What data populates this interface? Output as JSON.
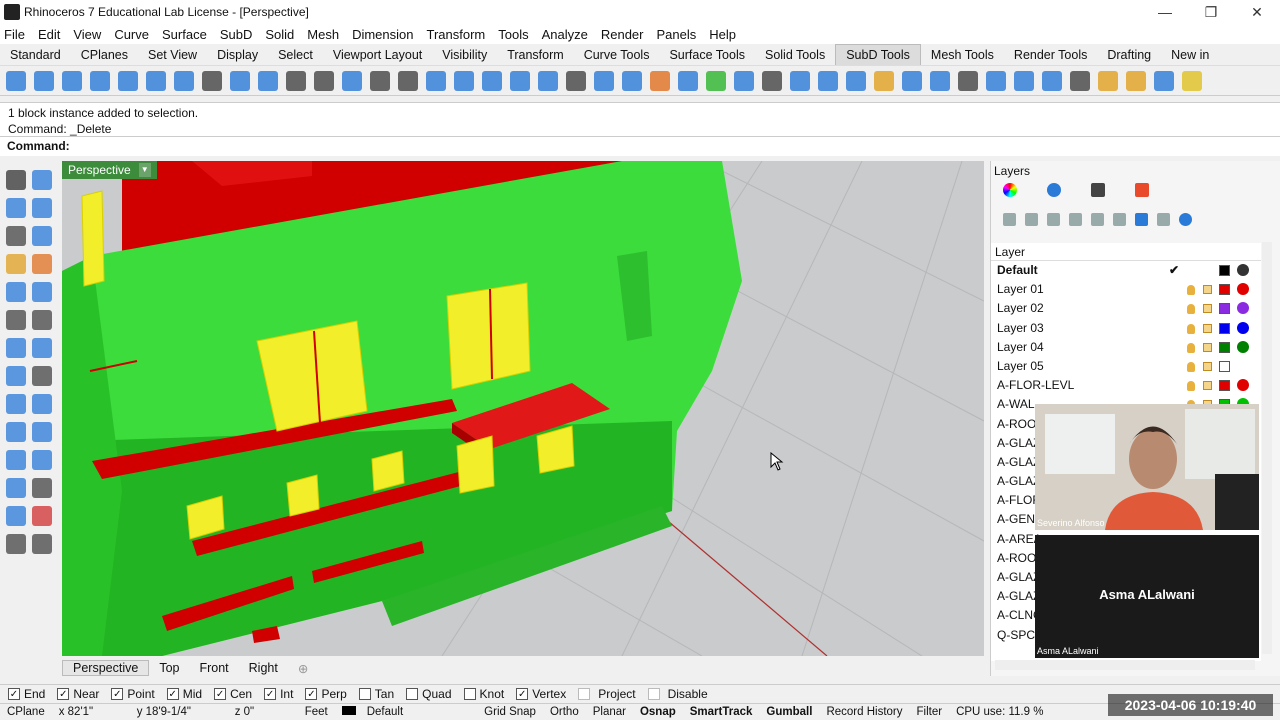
{
  "window": {
    "title": "Rhinoceros 7 Educational Lab License - [Perspective]"
  },
  "menu": [
    "File",
    "Edit",
    "View",
    "Curve",
    "Surface",
    "SubD",
    "Solid",
    "Mesh",
    "Dimension",
    "Transform",
    "Tools",
    "Analyze",
    "Render",
    "Panels",
    "Help"
  ],
  "tabs": [
    "Standard",
    "CPlanes",
    "Set View",
    "Display",
    "Select",
    "Viewport Layout",
    "Visibility",
    "Transform",
    "Curve Tools",
    "Surface Tools",
    "Solid Tools",
    "SubD Tools",
    "Mesh Tools",
    "Render Tools",
    "Drafting",
    "New in"
  ],
  "active_tab": "SubD Tools",
  "command": {
    "history": [
      "1 block instance added to selection.",
      "Command: _Delete"
    ],
    "prompt": "Command:"
  },
  "viewport": {
    "name": "Perspective"
  },
  "view_tabs": [
    "Perspective",
    "Top",
    "Front",
    "Right"
  ],
  "layers_panel": {
    "title": "Layers",
    "column_header": "Layer",
    "layers": [
      {
        "name": "Default",
        "current": true,
        "color": "#000000",
        "material": "#333333"
      },
      {
        "name": "Layer 01",
        "color": "#e00000",
        "material": "#e00000"
      },
      {
        "name": "Layer 02",
        "color": "#8a2be2",
        "material": "#8a2be2"
      },
      {
        "name": "Layer 03",
        "color": "#0000ee",
        "material": "#0000ee"
      },
      {
        "name": "Layer 04",
        "color": "#008000",
        "material": "#008000"
      },
      {
        "name": "Layer 05",
        "color": "#ffffff",
        "material": "#ffffff"
      },
      {
        "name": "A-FLOR-LEVL",
        "color": "#e00000",
        "material": "#e00000"
      },
      {
        "name": "A-WAL",
        "color": "#00c000",
        "material": "#00c000"
      },
      {
        "name": "A-ROO",
        "color": "",
        "material": ""
      },
      {
        "name": "A-GLAZ",
        "color": "",
        "material": ""
      },
      {
        "name": "A-GLAZ",
        "color": "",
        "material": ""
      },
      {
        "name": "A-GLAZ",
        "color": "",
        "material": ""
      },
      {
        "name": "A-FLOF",
        "color": "",
        "material": ""
      },
      {
        "name": "A-GENI",
        "color": "",
        "material": ""
      },
      {
        "name": "A-AREA",
        "color": "",
        "material": ""
      },
      {
        "name": "A-ROO",
        "color": "",
        "material": ""
      },
      {
        "name": "A-GLAZ",
        "color": "",
        "material": ""
      },
      {
        "name": "A-GLAZ",
        "color": "",
        "material": ""
      },
      {
        "name": "A-CLNG",
        "color": "",
        "material": ""
      },
      {
        "name": "Q-SPCQ",
        "color": "",
        "material": ""
      }
    ]
  },
  "webcams": {
    "person1": "Severino Alfonso",
    "person2_big": "Asma ALalwani",
    "person2_small": "Asma ALalwani"
  },
  "osnaps": [
    {
      "label": "End",
      "checked": true
    },
    {
      "label": "Near",
      "checked": true
    },
    {
      "label": "Point",
      "checked": true
    },
    {
      "label": "Mid",
      "checked": true
    },
    {
      "label": "Cen",
      "checked": true
    },
    {
      "label": "Int",
      "checked": true
    },
    {
      "label": "Perp",
      "checked": true
    },
    {
      "label": "Tan",
      "checked": false
    },
    {
      "label": "Quad",
      "checked": false
    },
    {
      "label": "Knot",
      "checked": false
    },
    {
      "label": "Vertex",
      "checked": true
    },
    {
      "label": "Project",
      "checked": false
    },
    {
      "label": "Disable",
      "checked": false
    }
  ],
  "status": {
    "cplane": "CPlane",
    "x": "x 82'1\"",
    "y": "y 18'9-1/4\"",
    "z": "z 0\"",
    "units": "Feet",
    "layer": "Default",
    "grid_snap": "Grid Snap",
    "ortho": "Ortho",
    "planar": "Planar",
    "osnap": "Osnap",
    "smarttrack": "SmartTrack",
    "gumball": "Gumball",
    "record_history": "Record History",
    "filter": "Filter",
    "cpu": "CPU use: 11.9 %"
  },
  "timestamp": "2023-04-06  10:19:40"
}
